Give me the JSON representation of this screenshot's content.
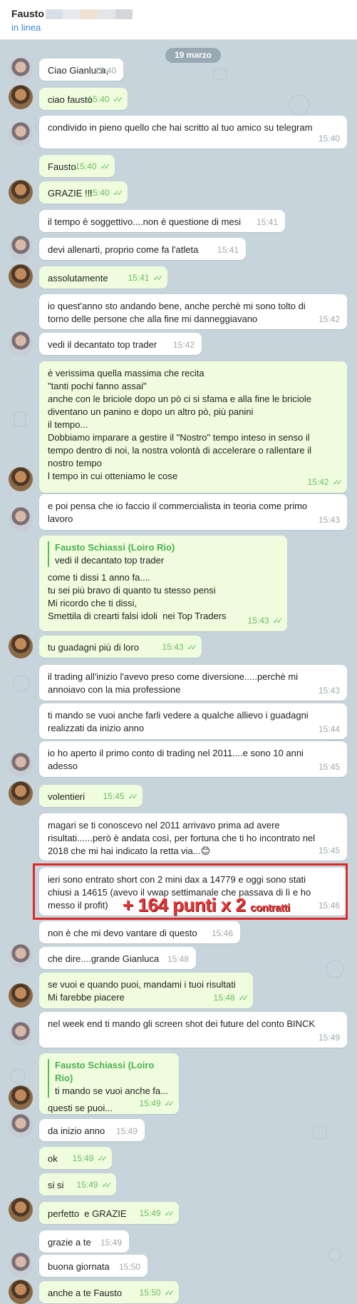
{
  "header": {
    "contact_name": "Fausto",
    "status": "in linea",
    "redaction_colors": [
      "#d6dfe8",
      "#e7e9ee",
      "#f0e2d3",
      "#e3e5e9",
      "#d4d6da"
    ]
  },
  "date_pill": "19 marzo",
  "overlay": {
    "main": "+ 164 punti x 2",
    "small": "contratti"
  },
  "messages": [
    {
      "text": "Ciao Gianluca,",
      "time": "15:40"
    },
    {
      "text": "ciao fausto",
      "time": "15:40"
    },
    {
      "text": "condivido in pieno quello che hai scritto al tuo amico su telegram",
      "time": "15:40"
    },
    {
      "text": "Fausto",
      "time": "15:40"
    },
    {
      "text": "GRAZIE !!!",
      "time": "15:40"
    },
    {
      "text": "il tempo è soggettivo....non è questione di mesi",
      "time": "15:41"
    },
    {
      "text": "devi allenarti, proprio come fa l'atleta",
      "time": "15:41"
    },
    {
      "text": "assolutamente",
      "time": "15:41"
    },
    {
      "text": "io quest'anno sto andando bene, anche perchè mi sono tolto di\ntorno delle persone che alla fine mi danneggiavano",
      "time": "15:42"
    },
    {
      "text": "vedi il decantato top trader",
      "time": "15:42"
    },
    {
      "text": "è verissima quella massima che recita\n\"tanti pochi fanno assai\"\nanche con le briciole dopo un pò ci si sfama e alla fine le briciole\ndiventano un panino e dopo un altro pò, più panini\nil tempo...\nDobbiamo imparare a gestire il \"Nostro\" tempo inteso in senso il\ntempo dentro di noi, la nostra volontà di accelerare o rallentare il\nnostro tempo\nl tempo in cui otteniamo le cose",
      "time": "15:42"
    },
    {
      "text": "e poi pensa che io faccio il commercialista in teoria come primo\nlavoro",
      "time": "15:43"
    },
    {
      "quote_name": "Fausto Schiassi (Loiro Rio)",
      "quote_text": "vedi il decantato top trader",
      "text": "come ti dissi 1 anno fa....\ntu sei più bravo di quanto tu stesso pensi\nMi ricordo che ti dissi,\nSmettila di crearti falsi idoli  nei Top Traders",
      "time": "15:43"
    },
    {
      "text": "tu guadagni più di loro",
      "time": "15:43"
    },
    {
      "text": "il trading all'inizio l'avevo preso come diversione.....perchè mi\nannoiavo con la mia professione",
      "time": "15:43"
    },
    {
      "text": "ti mando se vuoi anche farli vedere a qualche allievo i guadagni\nrealizzati da inizio anno",
      "time": "15:44"
    },
    {
      "text": "io ho aperto il primo conto di trading nel 2011....e sono 10 anni\nadesso",
      "time": "15:45"
    },
    {
      "text": "volentieri",
      "time": "15:45"
    },
    {
      "text": "magari se ti conoscevo nel 2011 arrivavo prima ad avere\nrisultati......però è andata così, per fortuna che ti ho incontrato nel\n2018 che mi hai indicato la retta via...😊",
      "time": "15:45"
    },
    {
      "text": "ieri sono entrato short con 2 mini dax a 14779 e oggi sono stati\nchiusi a 14615 (avevo il vwap settimanale che passava di lì e ho\nmesso il profit)",
      "time": "15:46"
    },
    {
      "text": "non è che mi devo vantare di questo",
      "time": "15:46"
    },
    {
      "text": "che dire....grande Gianluca",
      "time": "15:48"
    },
    {
      "text": "se vuoi e quando puoi, mandami i tuoi risultati\nMi farebbe piacere",
      "time": "15:48"
    },
    {
      "text": "nel week end ti mando gli screen shot dei future del conto BINCK",
      "time": "15:49"
    },
    {
      "quote_name": "Fausto Schiassi (Loiro Rio)",
      "quote_text": "ti mando se vuoi anche fa...",
      "text": "questi se puoi...",
      "time": "15:49"
    },
    {
      "text": "da inizio anno",
      "time": "15:49"
    },
    {
      "text": "ok",
      "time": "15:49"
    },
    {
      "text": "si si",
      "time": "15:49"
    },
    {
      "text": "perfetto  e GRAZIE",
      "time": "15:49"
    },
    {
      "text": "grazie a te",
      "time": "15:49"
    },
    {
      "text": "buona giornata",
      "time": "15:50"
    },
    {
      "text": "anche a te Fausto",
      "time": "15:50"
    }
  ]
}
